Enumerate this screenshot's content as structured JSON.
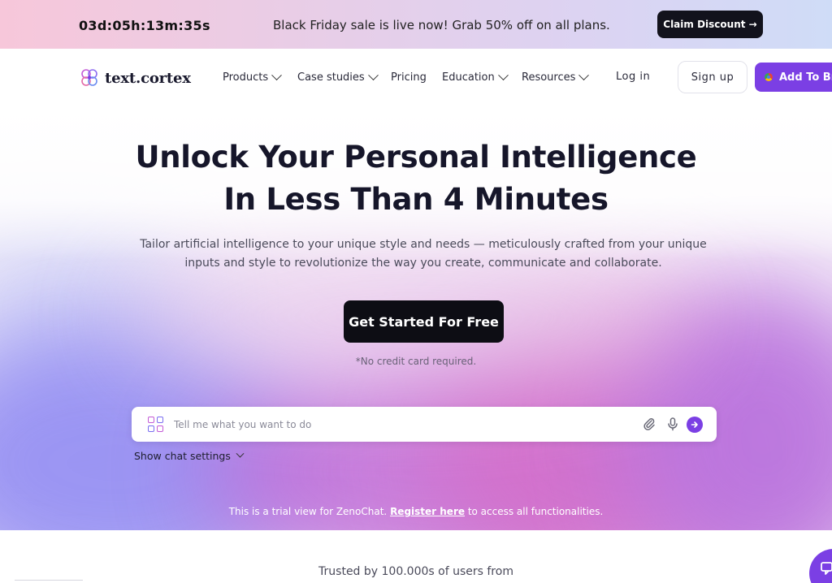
{
  "promo": {
    "countdown": "03d:05h:13m:35s",
    "text": "Black Friday sale is live now! Grab 50% off on all plans.",
    "claim_label": "Claim Discount →"
  },
  "nav": {
    "logo_text": "text.cortex",
    "items": [
      {
        "label": "Products",
        "has_dropdown": true
      },
      {
        "label": "Case studies",
        "has_dropdown": true
      },
      {
        "label": "Pricing",
        "has_dropdown": false
      },
      {
        "label": "Education",
        "has_dropdown": true
      },
      {
        "label": "Resources",
        "has_dropdown": true
      }
    ],
    "login_label": "Log in",
    "signup_label": "Sign up",
    "add_browser_label": "Add To Bro"
  },
  "hero": {
    "headline_line1": "Unlock Your Personal Intelligence",
    "headline_line2": "In Less Than 4 Minutes",
    "subtitle": "Tailor artificial intelligence to your unique style and needs — meticulously crafted from your unique inputs and style to revolutionize the way you create, communicate and collaborate.",
    "cta_label": "Get Started For Free",
    "no_credit_card": "*No credit card required."
  },
  "chat": {
    "placeholder": "Tell me what you want to do",
    "settings_label": "Show chat settings"
  },
  "trial": {
    "prefix": "This is a trial view for ZenoChat. ",
    "link": "Register here",
    "suffix": " to access all functionalities."
  },
  "trusted_text": "Trusted by 100.000s of users from",
  "colors": {
    "accent": "#7b3fe4",
    "dark_button": "#0d0d14"
  }
}
